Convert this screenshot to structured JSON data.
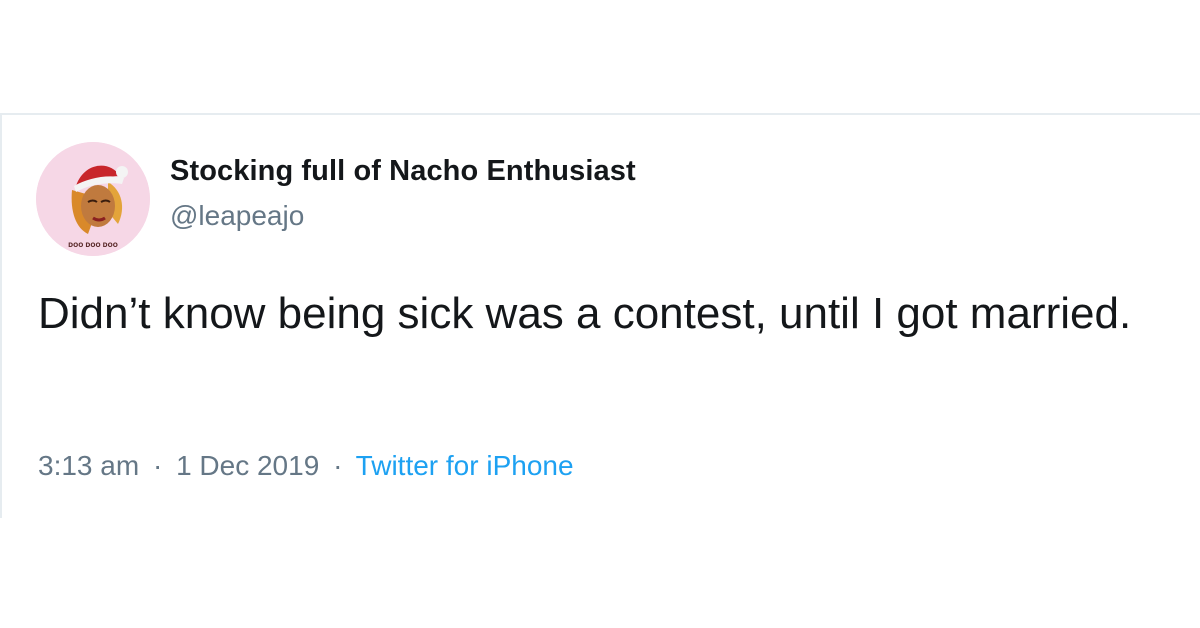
{
  "author": {
    "display_name": "Stocking full of Nacho Enthusiast",
    "handle": "@leapeajo",
    "avatar_icon": "cartoon-woman-santa-hat-icon",
    "avatar_caption": "DOO DOO DOO"
  },
  "tweet": {
    "text": "Didn’t know being sick was a contest, until I got married."
  },
  "meta": {
    "time": "3:13 am",
    "separator": "·",
    "date": "1 Dec 2019",
    "source": "Twitter for iPhone"
  },
  "colors": {
    "text_primary": "#14171a",
    "text_secondary": "#657786",
    "link": "#1da1f2",
    "border": "#e6ecf0",
    "avatar_bg": "#f6d7e6"
  }
}
